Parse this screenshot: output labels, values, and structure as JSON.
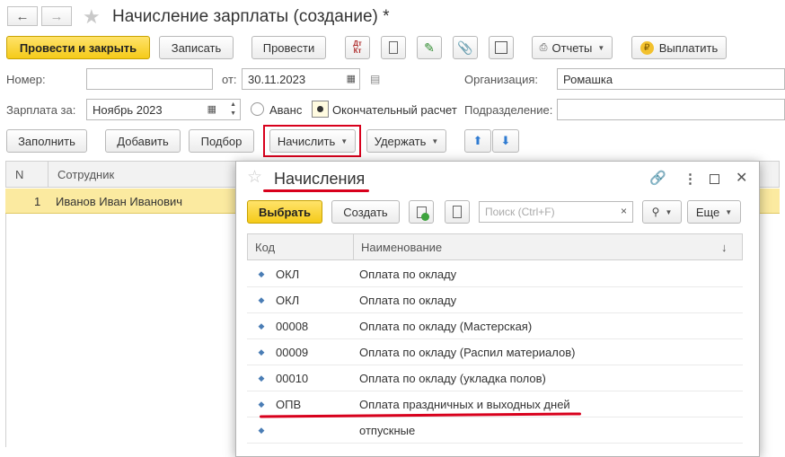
{
  "window": {
    "title": "Начисление зарплаты (создание) *"
  },
  "toolbar": {
    "post_close": "Провести и закрыть",
    "save": "Записать",
    "post": "Провести",
    "reports": "Отчеты",
    "pay": "Выплатить"
  },
  "form": {
    "number_label": "Номер:",
    "number_value": "",
    "date_label": "от:",
    "date_value": "30.11.2023",
    "org_label": "Организация:",
    "org_value": "Ромашка",
    "salary_label": "Зарплата за:",
    "salary_value": "Ноябрь 2023",
    "advance_label": "Аванс",
    "final_label": "Окончательный расчет",
    "division_label": "Подразделение:",
    "division_value": ""
  },
  "table_toolbar": {
    "fill": "Заполнить",
    "add": "Добавить",
    "pick": "Подбор",
    "accrue": "Начислить",
    "withhold": "Удержать"
  },
  "table": {
    "col_n": "N",
    "col_employee": "Сотрудник",
    "rows": [
      {
        "n": "1",
        "employee": "Иванов Иван Иванович"
      }
    ]
  },
  "popup": {
    "title": "Начисления",
    "select": "Выбрать",
    "create": "Создать",
    "search_placeholder": "Поиск (Ctrl+F)",
    "more": "Еще",
    "col_code": "Код",
    "col_name": "Наименование",
    "sort_arrow": "↓",
    "rows": [
      {
        "code": "ОКЛ",
        "name": "Оплата по окладу"
      },
      {
        "code": "ОКЛ",
        "name": "Оплата по окладу"
      },
      {
        "code": "00008",
        "name": "Оплата по окладу (Мастерская)"
      },
      {
        "code": "00009",
        "name": "Оплата по окладу (Распил материалов)"
      },
      {
        "code": "00010",
        "name": "Оплата по окладу (укладка полов)"
      },
      {
        "code": "ОПВ",
        "name": "Оплата праздничных и выходных дней"
      },
      {
        "code": "",
        "name": "отпускные"
      }
    ]
  },
  "colors": {
    "accent_yellow": "#f5cb19",
    "selected_row": "#fbeaa0",
    "highlight_red": "#d8001c",
    "icon_blue": "#2f7bd1"
  }
}
